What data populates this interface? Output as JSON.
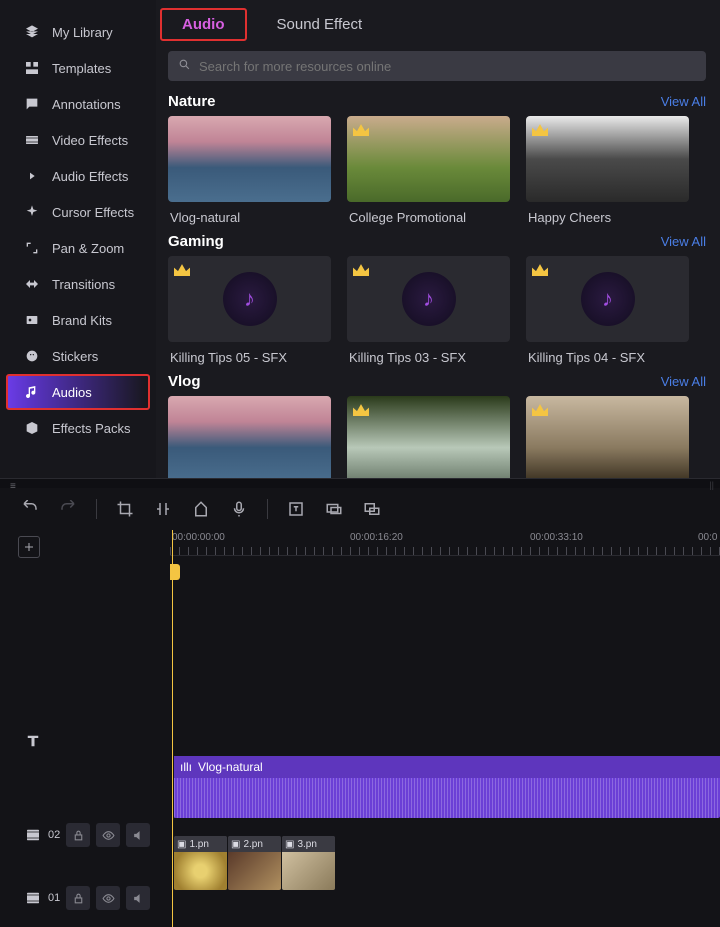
{
  "sidebar": {
    "items": [
      {
        "label": "My Library"
      },
      {
        "label": "Templates"
      },
      {
        "label": "Annotations"
      },
      {
        "label": "Video Effects"
      },
      {
        "label": "Audio Effects"
      },
      {
        "label": "Cursor Effects"
      },
      {
        "label": "Pan & Zoom"
      },
      {
        "label": "Transitions"
      },
      {
        "label": "Brand Kits"
      },
      {
        "label": "Stickers"
      },
      {
        "label": "Audios"
      },
      {
        "label": "Effects Packs"
      }
    ]
  },
  "tabs": {
    "audio": "Audio",
    "sfx": "Sound Effect"
  },
  "search": {
    "placeholder": "Search for more resources online"
  },
  "sections": {
    "nature": {
      "title": "Nature",
      "view_all": "View All",
      "cards": [
        {
          "label": "Vlog-natural",
          "premium": false
        },
        {
          "label": "College Promotional",
          "premium": true
        },
        {
          "label": "Happy Cheers",
          "premium": true
        }
      ]
    },
    "gaming": {
      "title": "Gaming",
      "view_all": "View All",
      "cards": [
        {
          "label": "Killing Tips 05 - SFX",
          "premium": true
        },
        {
          "label": "Killing Tips 03 - SFX",
          "premium": true
        },
        {
          "label": "Killing Tips 04 - SFX",
          "premium": true
        }
      ]
    },
    "vlog": {
      "title": "Vlog",
      "view_all": "View All",
      "cards": [
        {
          "label": "",
          "premium": false
        },
        {
          "label": "",
          "premium": true
        },
        {
          "label": "",
          "premium": true
        }
      ]
    }
  },
  "timeline": {
    "ruler": [
      "00:00:00:00",
      "00:00:16:20",
      "00:00:33:10",
      "00:0"
    ],
    "track02": "02",
    "track01": "01",
    "audio_clip": "Vlog-natural",
    "vclips": [
      "1.pn",
      "2.pn",
      "3.pn"
    ]
  }
}
